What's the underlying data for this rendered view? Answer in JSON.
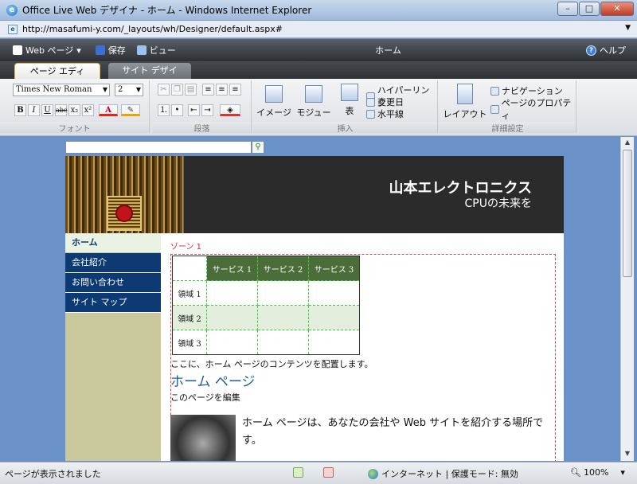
{
  "window": {
    "title": "Office Live Web デザイナ - ホーム - Windows Internet Explorer",
    "url": "http://masafumi-y.com/_layouts/wh/Designer/default.aspx#"
  },
  "toolbar": {
    "webpage_label": "Web ページ",
    "save_label": "保存",
    "view_label": "ビュー",
    "center_title": "ホーム",
    "help_label": "ヘルプ"
  },
  "tabs": [
    {
      "label": "ページ エディタ"
    },
    {
      "label": "サイト デザイナ"
    }
  ],
  "ribbon": {
    "font_name": "Times New Roman",
    "font_size": "2",
    "groups": {
      "font": "フォント",
      "paragraph": "段落",
      "insert": "挿入",
      "details": "詳細設定"
    },
    "insert_big": [
      {
        "label": "イメージ"
      },
      {
        "label": "モジュール"
      },
      {
        "label": "表"
      }
    ],
    "insert_small": [
      {
        "label": "ハイパーリンク"
      },
      {
        "label": "変更日"
      },
      {
        "label": "水平線"
      }
    ],
    "layout_label": "レイアウト",
    "details_small": [
      {
        "label": "ナビゲーション"
      },
      {
        "label": "ページのプロパティ"
      }
    ],
    "format_buttons": [
      "B",
      "I",
      "U",
      "abc",
      "x₂",
      "x²"
    ]
  },
  "site": {
    "title": "山本エレクトロニクス",
    "subtitle": "CPUの未来を",
    "nav": [
      {
        "label": "ホーム",
        "active": true
      },
      {
        "label": "会社紹介"
      },
      {
        "label": "お問い合わせ"
      },
      {
        "label": "サイト マップ"
      }
    ],
    "zone_label": "ゾーン 1",
    "table": {
      "headers": [
        "サービス 1",
        "サービス 2",
        "サービス 3"
      ],
      "rows": [
        "領域 1",
        "領域 2",
        "領域 3"
      ]
    },
    "caption": "ここに、ホーム ページのコンテンツを配置します。",
    "heading": "ホーム ページ",
    "edit_link": "このページを編集",
    "body": "ホーム ページは、あなたの会社や Web サイトを紹介する場所です。"
  },
  "status": {
    "message": "ページが表示されました",
    "zone": "インターネット | 保護モード: 無効",
    "zoom": "100%"
  }
}
